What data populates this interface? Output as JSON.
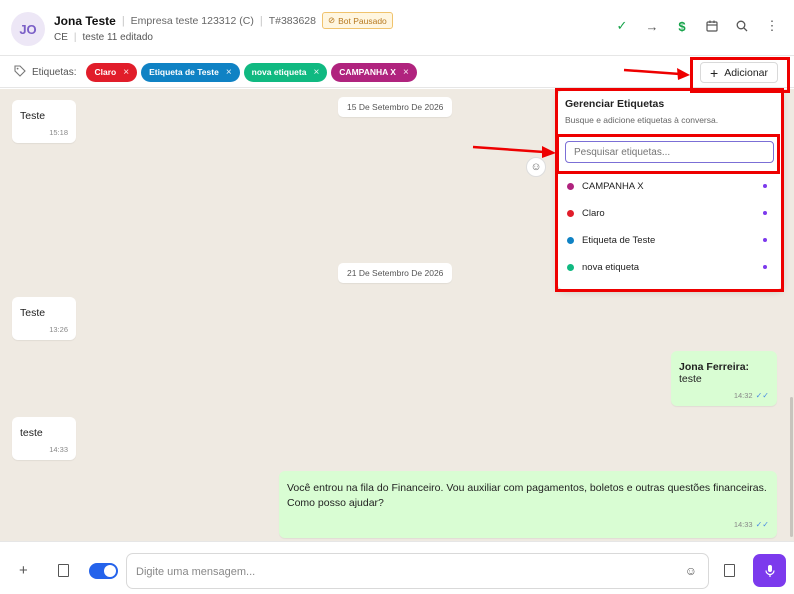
{
  "header": {
    "avatar_initials": "JO",
    "contact_name": "Jona Teste",
    "company": "Empresa teste 123312 (C)",
    "ticket": "T#383628",
    "bot_badge": "Bot Pausado",
    "state": "CE",
    "subtitle": "teste 11 editado",
    "actions": [
      "check-circle-icon",
      "arrow-right-icon",
      "dollar-icon",
      "calendar-icon",
      "search-icon",
      "more-vertical-icon"
    ]
  },
  "tagbar": {
    "label": "Etiquetas:",
    "tags": [
      {
        "label": "Claro",
        "color": "#e11d2a"
      },
      {
        "label": "Etiqueta de Teste",
        "color": "#0f82c4"
      },
      {
        "label": "nova etiqueta",
        "color": "#10b981"
      },
      {
        "label": "CAMPANHA X",
        "color": "#b0237e"
      }
    ],
    "remove_symbol": "×",
    "add_button": "Adicionar"
  },
  "chat": {
    "dates": [
      "15 De Setembro De 2026",
      "21 De Setembro De 2026"
    ],
    "messages": [
      {
        "text": "Teste",
        "time": "15:18"
      },
      {
        "text": "Teste",
        "time": "13:26"
      },
      {
        "author": "Jona Ferreira:",
        "text": "teste",
        "time": "14:32"
      },
      {
        "text": "teste",
        "time": "14:33"
      },
      {
        "text": "Você entrou na fila do Financeiro. Vou auxiliar com pagamentos, boletos e outras questões financeiras. Como posso ajudar?",
        "time": "14:33"
      }
    ]
  },
  "popover": {
    "title": "Gerenciar Etiquetas",
    "subtitle": "Busque e adicione etiquetas à conversa.",
    "search_placeholder": "Pesquisar etiquetas...",
    "items": [
      {
        "label": "CAMPANHA X",
        "color": "#b0237e"
      },
      {
        "label": "Claro",
        "color": "#e11d2a"
      },
      {
        "label": "Etiqueta de Teste",
        "color": "#0f82c4"
      },
      {
        "label": "nova etiqueta",
        "color": "#10b981"
      }
    ]
  },
  "composer": {
    "placeholder": "Digite uma mensagem..."
  },
  "colors": {
    "accent": "#7c3aed",
    "annotation_red": "#e00000",
    "chat_bg": "#efeae2",
    "outgoing_bg": "#d9fdd3"
  }
}
